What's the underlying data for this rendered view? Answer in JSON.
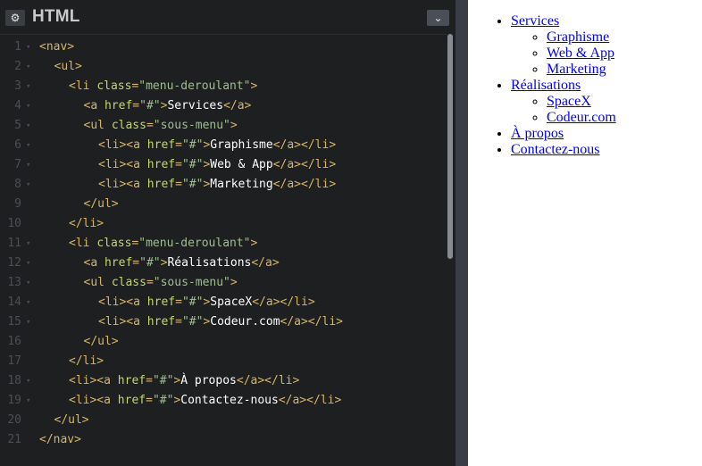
{
  "editor": {
    "title": "HTML",
    "settings_icon": "⚙",
    "collapse_icon": "⌄",
    "lines": [
      {
        "n": "1",
        "fold": "▾",
        "indent": 0,
        "parts": [
          [
            "tag",
            "<nav>"
          ]
        ]
      },
      {
        "n": "2",
        "fold": "▾",
        "indent": 1,
        "parts": [
          [
            "tag",
            "<ul>"
          ]
        ]
      },
      {
        "n": "3",
        "fold": "▾",
        "indent": 2,
        "parts": [
          [
            "tag",
            "<li "
          ],
          [
            "attr",
            "class"
          ],
          [
            "tag",
            "="
          ],
          [
            "str",
            "\"menu-deroulant\""
          ],
          [
            "tag",
            ">"
          ]
        ]
      },
      {
        "n": "4",
        "fold": "▾",
        "indent": 3,
        "parts": [
          [
            "tag",
            "<a "
          ],
          [
            "attr",
            "href"
          ],
          [
            "tag",
            "="
          ],
          [
            "str",
            "\"#\""
          ],
          [
            "tag",
            ">"
          ],
          [
            "txt",
            "Services"
          ],
          [
            "tag",
            "</a>"
          ]
        ]
      },
      {
        "n": "5",
        "fold": "▾",
        "indent": 3,
        "parts": [
          [
            "tag",
            "<ul "
          ],
          [
            "attr",
            "class"
          ],
          [
            "tag",
            "="
          ],
          [
            "str",
            "\"sous-menu\""
          ],
          [
            "tag",
            ">"
          ]
        ]
      },
      {
        "n": "6",
        "fold": "▾",
        "indent": 4,
        "parts": [
          [
            "tag",
            "<li><a "
          ],
          [
            "attr",
            "href"
          ],
          [
            "tag",
            "="
          ],
          [
            "str",
            "\"#\""
          ],
          [
            "tag",
            ">"
          ],
          [
            "txt",
            "Graphisme"
          ],
          [
            "tag",
            "</a></li>"
          ]
        ]
      },
      {
        "n": "7",
        "fold": "▾",
        "indent": 4,
        "parts": [
          [
            "tag",
            "<li><a "
          ],
          [
            "attr",
            "href"
          ],
          [
            "tag",
            "="
          ],
          [
            "str",
            "\"#\""
          ],
          [
            "tag",
            ">"
          ],
          [
            "txt",
            "Web & App"
          ],
          [
            "tag",
            "</a></li>"
          ]
        ]
      },
      {
        "n": "8",
        "fold": "▾",
        "indent": 4,
        "parts": [
          [
            "tag",
            "<li><a "
          ],
          [
            "attr",
            "href"
          ],
          [
            "tag",
            "="
          ],
          [
            "str",
            "\"#\""
          ],
          [
            "tag",
            ">"
          ],
          [
            "txt",
            "Marketing"
          ],
          [
            "tag",
            "</a></li>"
          ]
        ]
      },
      {
        "n": "9",
        "fold": "",
        "indent": 3,
        "parts": [
          [
            "tag",
            "</ul>"
          ]
        ]
      },
      {
        "n": "10",
        "fold": "",
        "indent": 2,
        "parts": [
          [
            "tag",
            "</li>"
          ]
        ]
      },
      {
        "n": "11",
        "fold": "▾",
        "indent": 2,
        "parts": [
          [
            "tag",
            "<li "
          ],
          [
            "attr",
            "class"
          ],
          [
            "tag",
            "="
          ],
          [
            "str",
            "\"menu-deroulant\""
          ],
          [
            "tag",
            ">"
          ]
        ]
      },
      {
        "n": "12",
        "fold": "▾",
        "indent": 3,
        "parts": [
          [
            "tag",
            "<a "
          ],
          [
            "attr",
            "href"
          ],
          [
            "tag",
            "="
          ],
          [
            "str",
            "\"#\""
          ],
          [
            "tag",
            ">"
          ],
          [
            "txt",
            "Réalisations"
          ],
          [
            "tag",
            "</a>"
          ]
        ]
      },
      {
        "n": "13",
        "fold": "▾",
        "indent": 3,
        "parts": [
          [
            "tag",
            "<ul "
          ],
          [
            "attr",
            "class"
          ],
          [
            "tag",
            "="
          ],
          [
            "str",
            "\"sous-menu\""
          ],
          [
            "tag",
            ">"
          ]
        ]
      },
      {
        "n": "14",
        "fold": "▾",
        "indent": 4,
        "parts": [
          [
            "tag",
            "<li><a "
          ],
          [
            "attr",
            "href"
          ],
          [
            "tag",
            "="
          ],
          [
            "str",
            "\"#\""
          ],
          [
            "tag",
            ">"
          ],
          [
            "txt",
            "SpaceX"
          ],
          [
            "tag",
            "</a></li>"
          ]
        ]
      },
      {
        "n": "15",
        "fold": "▾",
        "indent": 4,
        "parts": [
          [
            "tag",
            "<li><a "
          ],
          [
            "attr",
            "href"
          ],
          [
            "tag",
            "="
          ],
          [
            "str",
            "\"#\""
          ],
          [
            "tag",
            ">"
          ],
          [
            "txt",
            "Codeur.com"
          ],
          [
            "tag",
            "</a></li>"
          ]
        ]
      },
      {
        "n": "16",
        "fold": "",
        "indent": 3,
        "parts": [
          [
            "tag",
            "</ul>"
          ]
        ]
      },
      {
        "n": "17",
        "fold": "",
        "indent": 2,
        "parts": [
          [
            "tag",
            "</li>"
          ]
        ]
      },
      {
        "n": "18",
        "fold": "▾",
        "indent": 2,
        "parts": [
          [
            "tag",
            "<li><a "
          ],
          [
            "attr",
            "href"
          ],
          [
            "tag",
            "="
          ],
          [
            "str",
            "\"#\""
          ],
          [
            "tag",
            ">"
          ],
          [
            "txt",
            "À propos"
          ],
          [
            "tag",
            "</a></li>"
          ]
        ]
      },
      {
        "n": "19",
        "fold": "▾",
        "indent": 2,
        "parts": [
          [
            "tag",
            "<li><a "
          ],
          [
            "attr",
            "href"
          ],
          [
            "tag",
            "="
          ],
          [
            "str",
            "\"#\""
          ],
          [
            "tag",
            ">"
          ],
          [
            "txt",
            "Contactez-nous"
          ],
          [
            "tag",
            "</a></li>"
          ]
        ]
      },
      {
        "n": "20",
        "fold": "",
        "indent": 1,
        "parts": [
          [
            "tag",
            "</ul>"
          ]
        ]
      },
      {
        "n": "21",
        "fold": "",
        "indent": 0,
        "parts": [
          [
            "tag",
            "</nav>"
          ]
        ]
      }
    ]
  },
  "preview": {
    "menu": [
      {
        "label": "Services",
        "children": [
          "Graphisme",
          "Web & App",
          "Marketing"
        ]
      },
      {
        "label": "Réalisations",
        "children": [
          "SpaceX",
          "Codeur.com"
        ]
      },
      {
        "label": "À propos",
        "children": []
      },
      {
        "label": "Contactez-nous",
        "children": []
      }
    ]
  },
  "colors": {
    "editor_bg": "#1d1f20",
    "tag": "#d6b56a",
    "attribute": "#c1d86a",
    "string": "#9fbf8f",
    "link": "#0000ee"
  }
}
